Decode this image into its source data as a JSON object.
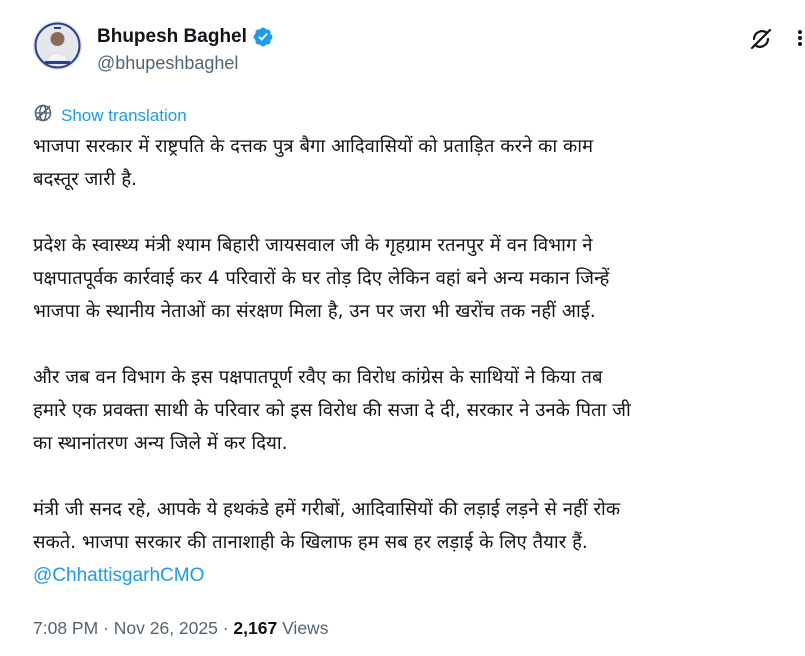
{
  "author": {
    "display_name": "Bhupesh Baghel",
    "handle": "@bhupeshbaghel",
    "verified": true,
    "avatar_caption": "STOP VOTE CHORI"
  },
  "actions": {
    "grok_icon": "grok-icon",
    "more_icon": "more-vertical-icon"
  },
  "translate": {
    "label": "Show translation",
    "icon": "translate-globe-icon"
  },
  "tweet": {
    "paragraphs": [
      "भाजपा सरकार में राष्ट्रपति के दत्तक पुत्र बैगा आदिवासियों को प्रताड़ित करने का काम\nबदस्तूर जारी है.",
      "प्रदेश के स्वास्थ्य मंत्री श्याम बिहारी जायसवाल जी के गृहग्राम रतनपुर में वन विभाग ने\nपक्षपातपूर्वक कार्रवाई कर 4 परिवारों के घर तोड़ दिए लेकिन वहां बने अन्य मकान जिन्हें\nभाजपा के स्थानीय नेताओं का संरक्षण मिला है, उन पर जरा भी खरोंच तक नहीं आई.",
      "और जब वन विभाग के इस पक्षपातपूर्ण रवैए का विरोध कांग्रेस के साथियों ने किया तब\nहमारे एक प्रवक्ता साथी के परिवार को इस विरोध की सजा दे दी, सरकार ने उनके पिता जी\nका स्थानांतरण अन्य जिले में कर दिया.",
      "मंत्री जी सनद रहे, आपके ये हथकंडे हमें गरीबों, आदिवासियों की लड़ाई लड़ने से नहीं रोक\nसकते. भाजपा सरकार की तानाशाही के खिलाफ हम सब हर लड़ाई के लिए तैयार हैं."
    ],
    "mention": "@ChhattisgarhCMO"
  },
  "meta": {
    "time": "7:08 PM",
    "separator": " · ",
    "date": "Nov 26, 2025",
    "views_count": "2,167",
    "views_label": " Views"
  },
  "colors": {
    "accent": "#1d9bf0",
    "text_primary": "#0f1419",
    "text_secondary": "#536471"
  }
}
